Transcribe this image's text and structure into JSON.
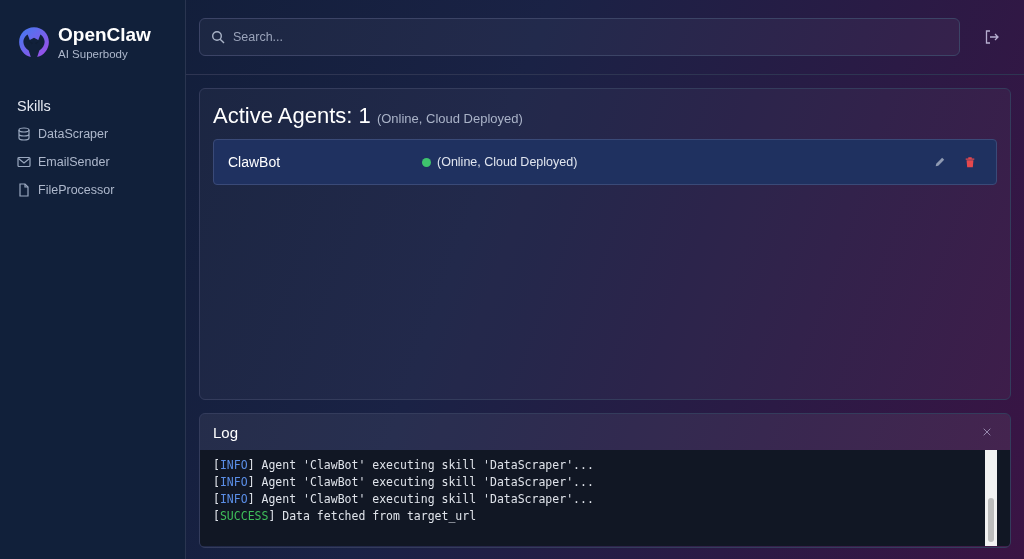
{
  "brand": {
    "name": "OpenClaw",
    "tagline": "AI Superbody"
  },
  "sidebar": {
    "heading": "Skills",
    "items": [
      {
        "label": "DataScraper",
        "kind": "database"
      },
      {
        "label": "EmailSender",
        "kind": "mail"
      },
      {
        "label": "FileProcessor",
        "kind": "file"
      }
    ]
  },
  "search": {
    "placeholder": "Search..."
  },
  "agents": {
    "title": "Active Agents: 1",
    "subtitle": "(Online, Cloud Deployed)",
    "rows": [
      {
        "name": "ClawBot",
        "status": "(Online, Cloud Deployed)",
        "color": "#3ec46d"
      }
    ]
  },
  "log": {
    "title": "Log",
    "lines": [
      {
        "kind": "info",
        "open": "[",
        "tag": "INFO",
        "rest": "] Agent 'ClawBot' executing skill 'DataScraper'..."
      },
      {
        "kind": "info",
        "open": "[",
        "tag": "INFO",
        "rest": "] Agent 'ClawBot' executing skill 'DataScraper'..."
      },
      {
        "kind": "info",
        "open": "[",
        "tag": "INFO",
        "rest": "] Agent 'ClawBot' executing skill 'DataScraper'..."
      },
      {
        "kind": "success",
        "open": "[",
        "tag": "SUCCESS",
        "rest": "] Data fetched from target_url"
      }
    ]
  }
}
